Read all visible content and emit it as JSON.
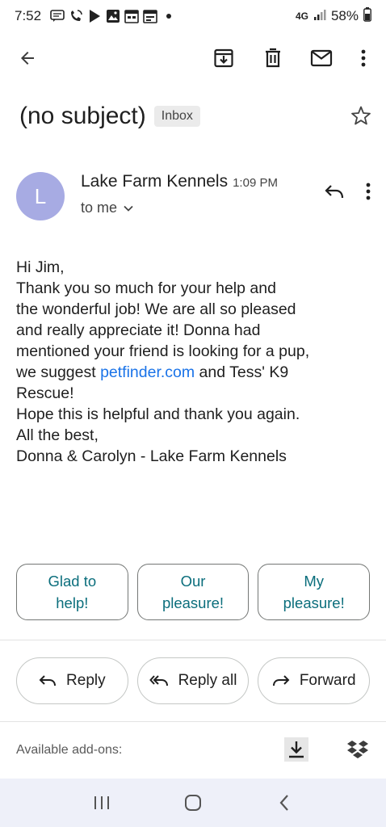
{
  "status_bar": {
    "time": "7:52",
    "network": "4G",
    "battery": "58%"
  },
  "toolbar": {
    "back_icon": "arrow-back-icon",
    "archive_icon": "archive-icon",
    "delete_icon": "trash-icon",
    "mark_unread_icon": "mail-icon",
    "more_icon": "more-vert-icon"
  },
  "email": {
    "subject": "(no subject)",
    "label": "Inbox",
    "sender": {
      "initial": "L",
      "name": "Lake Farm Kennels",
      "time": "1:09 PM",
      "recipient": "to me",
      "avatar_color": "#a7abe3"
    },
    "body": {
      "line1": "Hi Jim,",
      "line2": "Thank you so much for your help and",
      "line3": "the wonderful job!  We are all so pleased",
      "line4": "and really appreciate it!  Donna had",
      "line5": "mentioned your friend is looking for a pup,",
      "line6_before": "we suggest ",
      "line6_link": "petfinder.com",
      "line6_after": " and Tess' K9",
      "line7": "Rescue!",
      "line8": "Hope this is helpful and thank you again.",
      "line9": "All the best,",
      "line10": "Donna & Carolyn - Lake Farm Kennels"
    }
  },
  "smart_replies": {
    "reply1_line1": "Glad to",
    "reply1_line2": "help!",
    "reply2_line1": "Our",
    "reply2_line2": "pleasure!",
    "reply3_line1": "My",
    "reply3_line2": "pleasure!"
  },
  "actions": {
    "reply": "Reply",
    "reply_all": "Reply all",
    "forward": "Forward"
  },
  "addons": {
    "label": "Available add-ons:"
  },
  "colors": {
    "link": "#1a73e8",
    "smart_reply_text": "#0b6e7c",
    "nav_bar_bg": "#eef0f9"
  }
}
